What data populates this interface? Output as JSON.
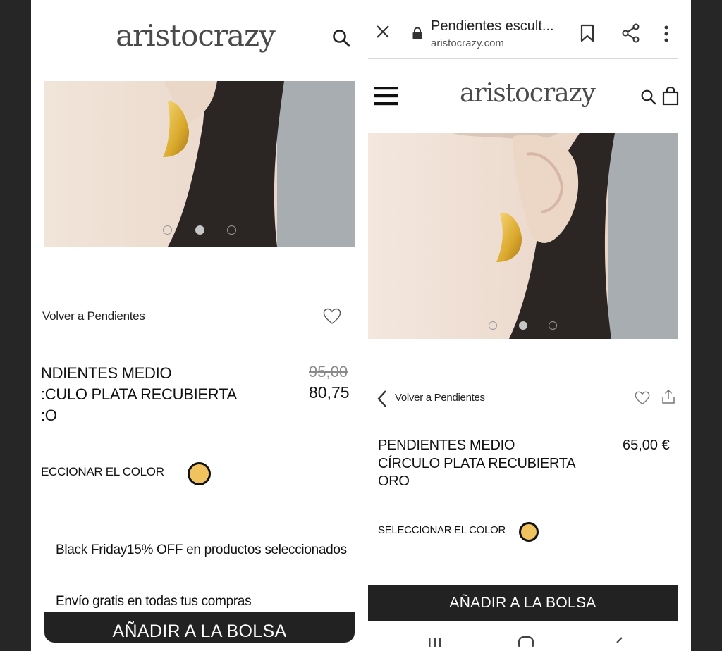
{
  "left_panel": {
    "logo": "aristocrazy",
    "back_link": "Volver a Pendientes",
    "product_name": "NDIENTES MEDIO\n:CULO PLATA RECUBIERTA\n:O",
    "old_price": "95,00",
    "price": "80,75",
    "color_label": "ECCIONAR EL COLOR",
    "swatch_color": "#f0c35e",
    "promo_1": "Black Friday15% OFF en productos seleccionados",
    "promo_2": "Envío gratis en todas tus compras",
    "add_button": "AÑADIR A LA BOLSA",
    "carousel": {
      "count": 3,
      "active": 2
    }
  },
  "right_panel": {
    "browser": {
      "tab_title": "Pendientes escult...",
      "url": "aristocrazy.com"
    },
    "logo": "aristocrazy",
    "back_link": "Volver a Pendientes",
    "product_name": "PENDIENTES MEDIO\nCÍRCULO PLATA RECUBIERTA\nORO",
    "price": "65,00 €",
    "color_label": "SELECCIONAR EL COLOR",
    "swatch_color": "#f0c35e",
    "add_button": "AÑADIR A LA BOLSA",
    "carousel": {
      "count": 3,
      "active": 2
    }
  },
  "icons": [
    "search-icon",
    "heart-icon",
    "close-icon",
    "lock-icon",
    "bookmark-icon",
    "share-icon",
    "more-icon",
    "menu-icon",
    "bag-icon",
    "chevron-left-icon",
    "upload-icon"
  ],
  "colors": {
    "background": "#262626",
    "button": "#222222",
    "accent_gold": "#f0c35e",
    "image_gray": "#a8adb2"
  }
}
